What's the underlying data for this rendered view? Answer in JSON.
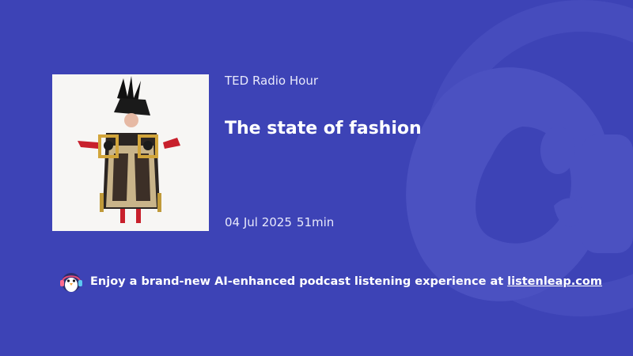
{
  "podcast": {
    "show_name": "TED Radio Hour",
    "episode_title": "The state of fashion",
    "date": "04 Jul 2025",
    "duration": "51min"
  },
  "promo": {
    "text": "Enjoy a brand-new AI-enhanced podcast listening experience at",
    "link_label": "listenleap.com",
    "icon": "penguin-headphones-icon"
  },
  "colors": {
    "background": "#3d43b6",
    "watermark": "#5158c4",
    "text": "#ffffff"
  }
}
